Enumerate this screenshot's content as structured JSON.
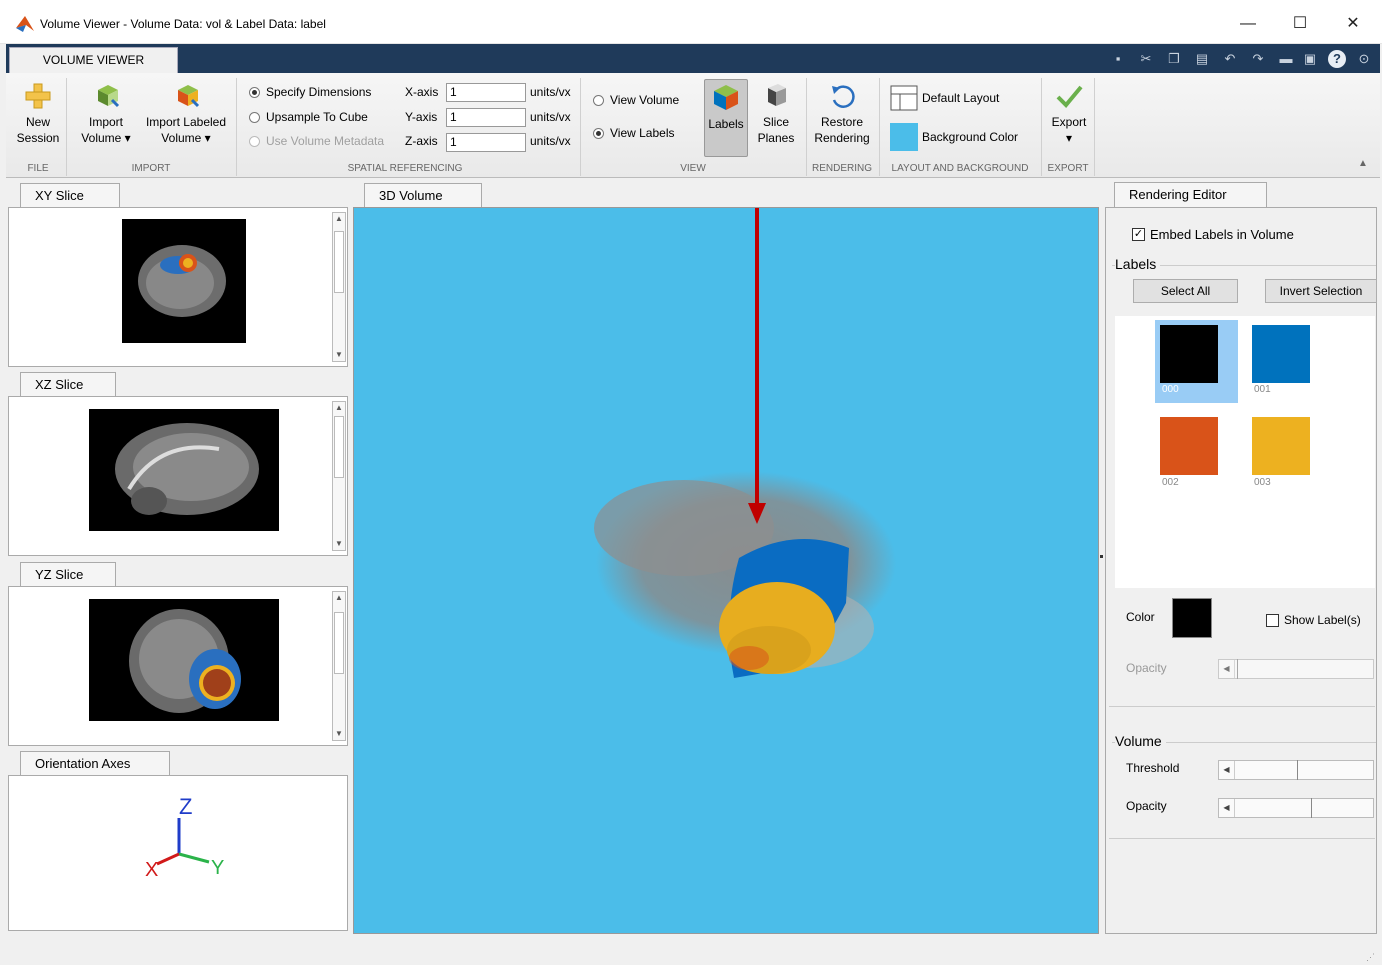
{
  "window": {
    "title": "Volume Viewer - Volume Data: vol & Label Data: label",
    "minimize": "—",
    "maximize": "☐",
    "close": "✕"
  },
  "ribbon_tab": "VOLUME VIEWER",
  "toolbar": {
    "new_session": [
      "New",
      "Session"
    ],
    "import_volume": [
      "Import",
      "Volume ▾"
    ],
    "import_labeled": [
      "Import Labeled",
      "Volume ▾"
    ],
    "specify_dimensions": "Specify Dimensions",
    "upsample": "Upsample To Cube",
    "use_metadata": "Use Volume Metadata",
    "x_axis": "X-axis",
    "y_axis": "Y-axis",
    "z_axis": "Z-axis",
    "x_val": "1",
    "y_val": "1",
    "z_val": "1",
    "units": "units/vx",
    "view_volume": "View Volume",
    "view_labels": "View Labels",
    "labels": "Labels",
    "slice_planes": [
      "Slice",
      "Planes"
    ],
    "restore_rendering": [
      "Restore",
      "Rendering"
    ],
    "default_layout": "Default Layout",
    "background_color": "Background Color",
    "export": "Export"
  },
  "sections": {
    "file": "FILE",
    "import": "IMPORT",
    "spatial": "SPATIAL REFERENCING",
    "view": "VIEW",
    "rendering": "RENDERING",
    "layout": "LAYOUT AND BACKGROUND",
    "export": "EXPORT"
  },
  "left_tabs": {
    "xy": "XY Slice",
    "xz": "XZ Slice",
    "yz": "YZ Slice",
    "orient": "Orientation Axes"
  },
  "axes": {
    "x": "X",
    "y": "Y",
    "z": "Z"
  },
  "center_tab": "3D Volume",
  "editor": {
    "tab": "Rendering Editor",
    "embed": "Embed Labels in Volume",
    "labels_group": "Labels",
    "select_all": "Select All",
    "invert": "Invert Selection",
    "swatches": [
      {
        "label": "000",
        "color": "#000000"
      },
      {
        "label": "001",
        "color": "#0072bd"
      },
      {
        "label": "002",
        "color": "#d95319"
      },
      {
        "label": "003",
        "color": "#edb120"
      }
    ],
    "color_label": "Color",
    "show_labels": "Show Label(s)",
    "opacity_label": "Opacity",
    "volume_group": "Volume",
    "threshold": "Threshold",
    "vol_opacity": "Opacity"
  },
  "colors": {
    "background": "#4bbde9",
    "accent_blue": "#0072bd",
    "orange": "#d95319",
    "yellow": "#edb120",
    "arrow": "#c00000"
  }
}
